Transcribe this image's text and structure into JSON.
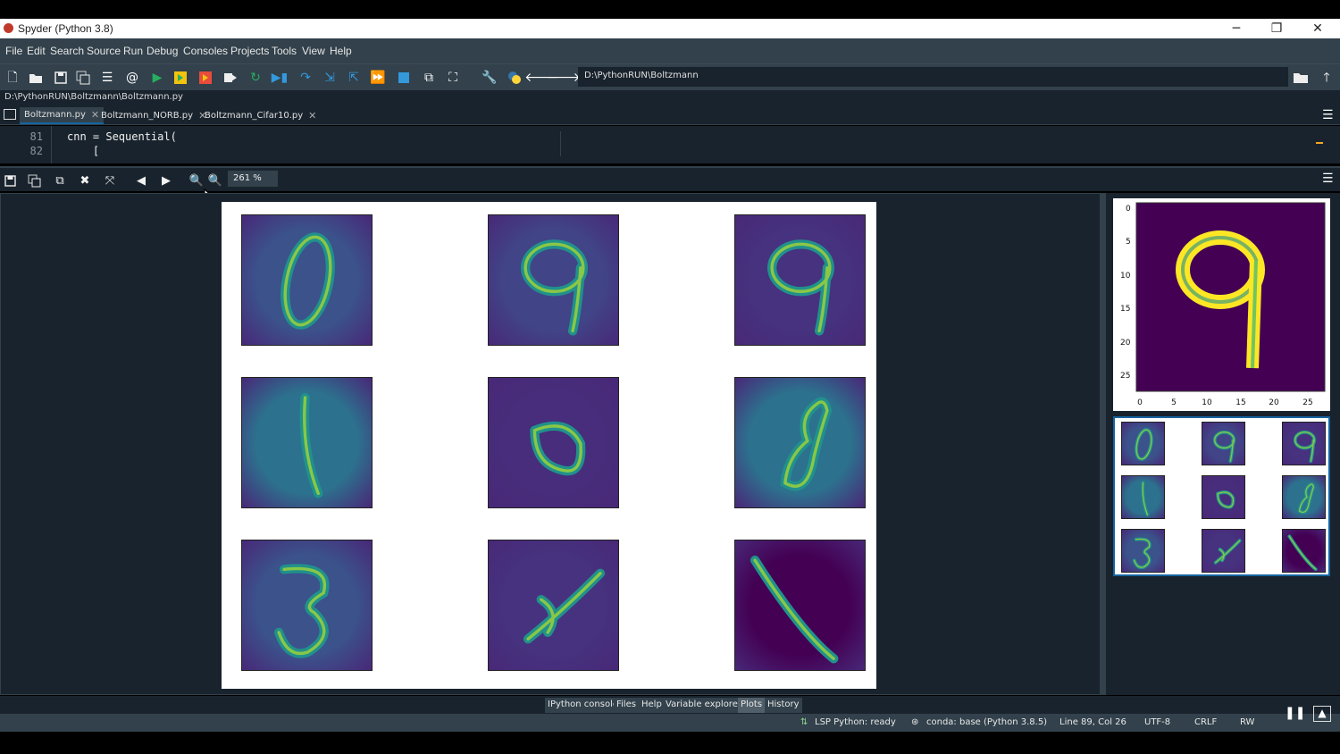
{
  "window": {
    "title": "Spyder (Python 3.8)",
    "minimize": "─",
    "maximize": "❐",
    "close": "✕"
  },
  "menu": [
    "File",
    "Edit",
    "Search",
    "Source",
    "Run",
    "Debug",
    "Consoles",
    "Projects",
    "Tools",
    "View",
    "Help"
  ],
  "toolbar": {
    "path": "D:\\PythonRUN\\Boltzmann",
    "icons": [
      "new-file-icon",
      "open-folder-icon",
      "save-icon",
      "save-all-icon",
      "outline-icon",
      "at-icon",
      "run-icon",
      "run-cell-icon",
      "run-cell-advance-icon",
      "run-selection-icon",
      "rerun-icon",
      "debug-icon",
      "step-icon",
      "step-into-icon",
      "step-return-icon",
      "continue-icon",
      "stop-icon",
      "maximize-pane-icon",
      "fullscreen-icon",
      "wrench-icon",
      "python-path-icon",
      "back-icon",
      "forward-icon"
    ]
  },
  "file_path": "D:\\PythonRUN\\Boltzmann\\Boltzmann.py",
  "editor_tabs": [
    {
      "label": "Boltzmann.py",
      "active": true
    },
    {
      "label": "Boltzmann_NORB.py",
      "active": false
    },
    {
      "label": "Boltzmann_Cifar10.py",
      "active": false
    }
  ],
  "editor": {
    "lines": [
      {
        "number": "81",
        "code": "cnn = Sequential("
      },
      {
        "number": "82",
        "code": "    ["
      }
    ]
  },
  "plots": {
    "zoom": "261 %",
    "main_figure": {
      "digits": [
        "0",
        "9",
        "9",
        "1",
        "6",
        "8",
        "3",
        "4",
        "7"
      ]
    },
    "thumbnail_single": {
      "digit": "9",
      "y_ticks": [
        "0",
        "5",
        "10",
        "15",
        "20",
        "25"
      ],
      "x_ticks": [
        "0",
        "5",
        "10",
        "15",
        "20",
        "25"
      ]
    },
    "thumbnail_grid": {
      "digits": [
        "0",
        "9",
        "9",
        "1",
        "6",
        "8",
        "3",
        "4",
        "7"
      ]
    }
  },
  "panel_tabs": [
    {
      "label": "IPython console",
      "active": false
    },
    {
      "label": "Files",
      "active": false
    },
    {
      "label": "Help",
      "active": false
    },
    {
      "label": "Variable explorer",
      "active": false
    },
    {
      "label": "Plots",
      "active": true
    },
    {
      "label": "History",
      "active": false
    }
  ],
  "status": {
    "lsp": "LSP Python: ready",
    "conda": "conda: base (Python 3.8.5)",
    "cursor": "Line 89, Col 26",
    "encoding": "UTF-8",
    "eol": "CRLF",
    "perm": "RW"
  },
  "colors": {
    "bg_dark": "#19232d",
    "bg_panel": "#32414b",
    "accent": "#1464a0",
    "viridis_dark": "#440154",
    "viridis_teal": "#21918c",
    "viridis_yellow": "#fde725"
  }
}
